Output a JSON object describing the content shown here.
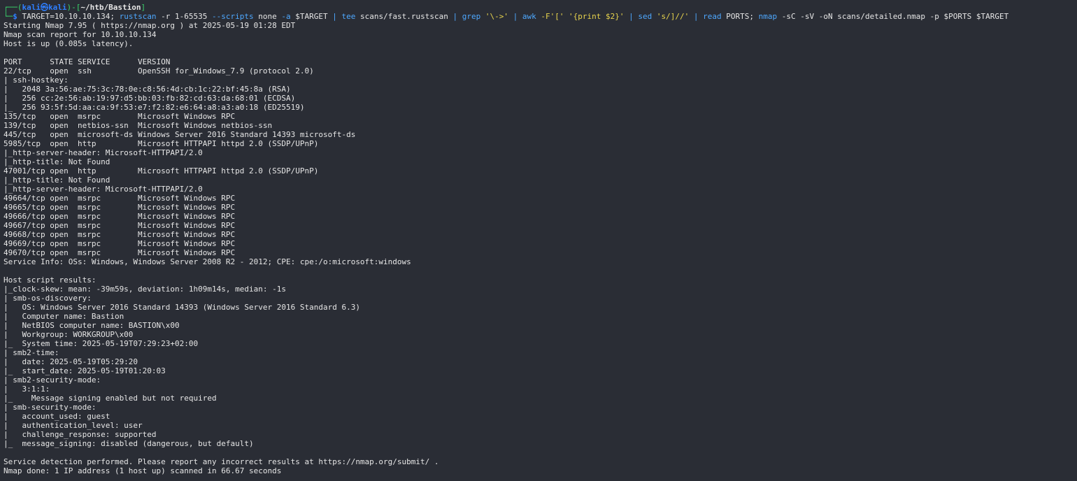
{
  "prompt": {
    "box_top": "┌──(",
    "user": "kali",
    "at": "㉿",
    "host": "kali",
    "mid": ")-[",
    "path": "~/htb/Bastion",
    "end": "]",
    "box_bottom": "└─",
    "dollar": "$"
  },
  "command": {
    "p1": " TARGET=10.10.10.134; ",
    "rustscan": "rustscan",
    "p2": " -r 1-65535 ",
    "opt_scripts": "--scripts",
    "p3": " none ",
    "opt_a": "-a",
    "p4": " $TARGET ",
    "pipe1": "|",
    "tee": " tee",
    "p5": " scans/fast.rustscan ",
    "pipe2": "|",
    "grep": " grep",
    "p6": " '\\->' ",
    "pipe3": "|",
    "awk": " awk",
    "p7": " -F'[' '{print $2}' ",
    "pipe4": "|",
    "sed": " sed",
    "p8": " 's/]//' ",
    "pipe5": "|",
    "read": " read",
    "p9": " PORTS; ",
    "nmap": "nmap",
    "p10": " -sC -sV -oN scans/detailed.nmap -p $PORTS $TARGET"
  },
  "output_lines": [
    "Starting Nmap 7.95 ( https://nmap.org ) at 2025-05-19 01:28 EDT",
    "Nmap scan report for 10.10.10.134",
    "Host is up (0.085s latency).",
    "",
    "PORT      STATE SERVICE      VERSION",
    "22/tcp    open  ssh          OpenSSH for_Windows_7.9 (protocol 2.0)",
    "| ssh-hostkey:",
    "|   2048 3a:56:ae:75:3c:78:0e:c8:56:4d:cb:1c:22:bf:45:8a (RSA)",
    "|   256 cc:2e:56:ab:19:97:d5:bb:03:fb:82:cd:63:da:68:01 (ECDSA)",
    "|_  256 93:5f:5d:aa:ca:9f:53:e7:f2:82:e6:64:a8:a3:a0:18 (ED25519)",
    "135/tcp   open  msrpc        Microsoft Windows RPC",
    "139/tcp   open  netbios-ssn  Microsoft Windows netbios-ssn",
    "445/tcp   open  microsoft-ds Windows Server 2016 Standard 14393 microsoft-ds",
    "5985/tcp  open  http         Microsoft HTTPAPI httpd 2.0 (SSDP/UPnP)",
    "|_http-server-header: Microsoft-HTTPAPI/2.0",
    "|_http-title: Not Found",
    "47001/tcp open  http         Microsoft HTTPAPI httpd 2.0 (SSDP/UPnP)",
    "|_http-title: Not Found",
    "|_http-server-header: Microsoft-HTTPAPI/2.0",
    "49664/tcp open  msrpc        Microsoft Windows RPC",
    "49665/tcp open  msrpc        Microsoft Windows RPC",
    "49666/tcp open  msrpc        Microsoft Windows RPC",
    "49667/tcp open  msrpc        Microsoft Windows RPC",
    "49668/tcp open  msrpc        Microsoft Windows RPC",
    "49669/tcp open  msrpc        Microsoft Windows RPC",
    "49670/tcp open  msrpc        Microsoft Windows RPC",
    "Service Info: OSs: Windows, Windows Server 2008 R2 - 2012; CPE: cpe:/o:microsoft:windows",
    "",
    "Host script results:",
    "|_clock-skew: mean: -39m59s, deviation: 1h09m14s, median: -1s",
    "| smb-os-discovery:",
    "|   OS: Windows Server 2016 Standard 14393 (Windows Server 2016 Standard 6.3)",
    "|   Computer name: Bastion",
    "|   NetBIOS computer name: BASTION\\x00",
    "|   Workgroup: WORKGROUP\\x00",
    "|_  System time: 2025-05-19T07:29:23+02:00",
    "| smb2-time:",
    "|   date: 2025-05-19T05:29:20",
    "|_  start_date: 2025-05-19T01:20:03",
    "| smb2-security-mode:",
    "|   3:1:1:",
    "|_    Message signing enabled but not required",
    "| smb-security-mode:",
    "|   account_used: guest",
    "|   authentication_level: user",
    "|   challenge_response: supported",
    "|_  message_signing: disabled (dangerous, but default)",
    "",
    "Service detection performed. Please report any incorrect results at https://nmap.org/submit/ .",
    "Nmap done: 1 IP address (1 host up) scanned in 66.67 seconds"
  ]
}
